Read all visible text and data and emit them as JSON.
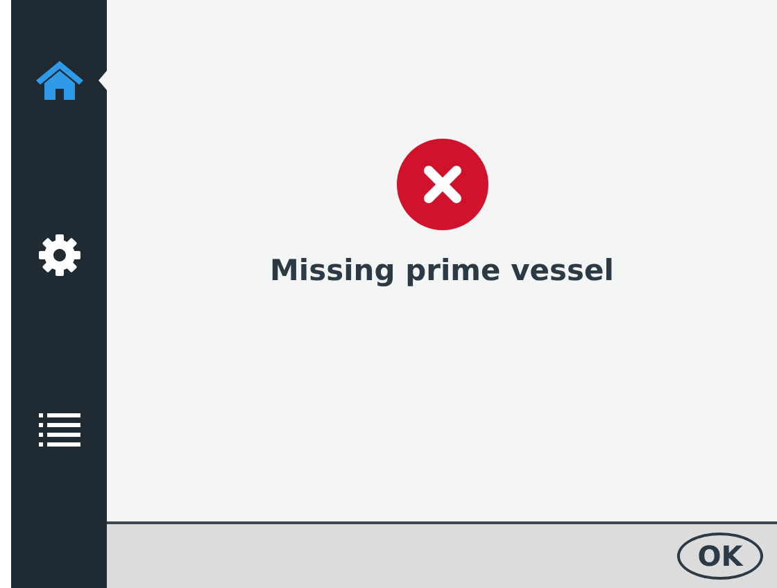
{
  "sidebar": {
    "items": [
      {
        "kind": "home",
        "selected": true
      },
      {
        "kind": "settings",
        "selected": false
      },
      {
        "kind": "list",
        "selected": false
      }
    ]
  },
  "message": {
    "kind": "error",
    "text": "Missing prime vessel"
  },
  "footer": {
    "buttons": [
      "OK"
    ]
  }
}
